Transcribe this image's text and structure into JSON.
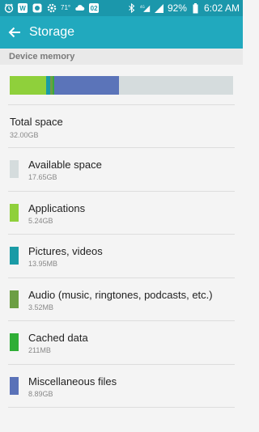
{
  "status_bar": {
    "icons": [
      "clock-icon",
      "w-app-icon",
      "notification-icon",
      "settings-icon",
      "calendar-icon"
    ],
    "temperature": "71°",
    "date_badge": "02",
    "battery_percent": "92%",
    "time": "6:02 AM"
  },
  "header": {
    "title": "Storage",
    "bg_color": "#21a9be"
  },
  "section": {
    "title": "Device memory"
  },
  "storage_bar": {
    "segments": [
      {
        "name": "Applications",
        "fraction": 0.164,
        "color": "#8fd03b"
      },
      {
        "name": "Pictures, videos",
        "fraction": 0.018,
        "color": "#1a9ba6"
      },
      {
        "name": "Audio",
        "fraction": 0.011,
        "color": "#6c9e44"
      },
      {
        "name": "Cached data",
        "fraction": 0.007,
        "color": "#3aab3a"
      },
      {
        "name": "Miscellaneous files",
        "fraction": 0.289,
        "color": "#5b74b9"
      },
      {
        "name": "Available space",
        "fraction": 0.511,
        "color": "#d5dcdd"
      }
    ]
  },
  "total": {
    "label": "Total space",
    "value": "32.00GB"
  },
  "items": [
    {
      "label": "Available space",
      "value": "17.65GB",
      "color": "#d5dcdd"
    },
    {
      "label": "Applications",
      "value": "5.24GB",
      "color": "#8fd03b"
    },
    {
      "label": "Pictures, videos",
      "value": "13.95MB",
      "color": "#1a9ba6"
    },
    {
      "label": "Audio (music, ringtones, podcasts, etc.)",
      "value": "3.52MB",
      "color": "#6c9e44"
    },
    {
      "label": "Cached data",
      "value": "211MB",
      "color": "#2fae36"
    },
    {
      "label": "Miscellaneous files",
      "value": "8.89GB",
      "color": "#5a72b8"
    }
  ]
}
